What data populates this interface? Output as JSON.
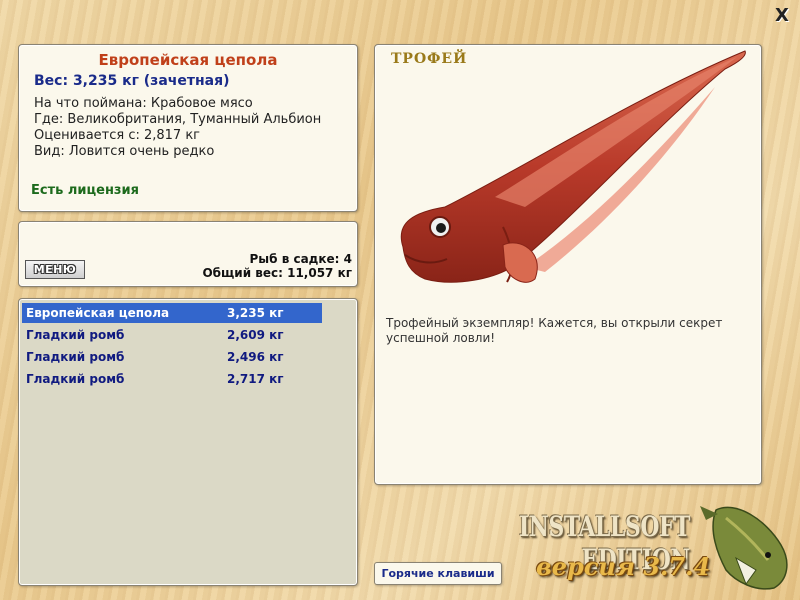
{
  "window": {
    "close_glyph": "X"
  },
  "info": {
    "title": "Европейская цепола",
    "weight": "Вес: 3,235 кг (зачетная)",
    "caught_on": "На что поймана: Крабовое мясо",
    "where": "Где: Великобритания, Туманный Альбион",
    "valued_from": "Оценивается с: 2,817 кг",
    "kind": "Вид: Ловится очень редко",
    "license": "Есть лицензия"
  },
  "summary": {
    "menu_label": "МЕНЮ",
    "fish_count": "Рыб в садке: 4",
    "total_weight": "Общий вес: 11,057 кг"
  },
  "fish_list": [
    {
      "name": "Европейская цепола",
      "weight": "3,235 кг",
      "selected": true
    },
    {
      "name": "Гладкий ромб",
      "weight": "2,609 кг",
      "selected": false
    },
    {
      "name": "Гладкий ромб",
      "weight": "2,496 кг",
      "selected": false
    },
    {
      "name": "Гладкий ромб",
      "weight": "2,717 кг",
      "selected": false
    }
  ],
  "trophy": {
    "label": "ТРОФЕЙ",
    "message": "Трофейный экземпляр! Кажется, вы открыли секрет успешной ловли!"
  },
  "hotkeys_label": "Горячие клавиши",
  "brand": {
    "edition": "INSTALLSOFT EDITION",
    "version": "версия 3.7.4"
  },
  "icons": [
    "close-icon",
    "fish-image",
    "pike-logo-icon"
  ],
  "colors": {
    "selected_row": "#3366cc",
    "title": "#c0401a",
    "license": "#1c6a1c"
  }
}
